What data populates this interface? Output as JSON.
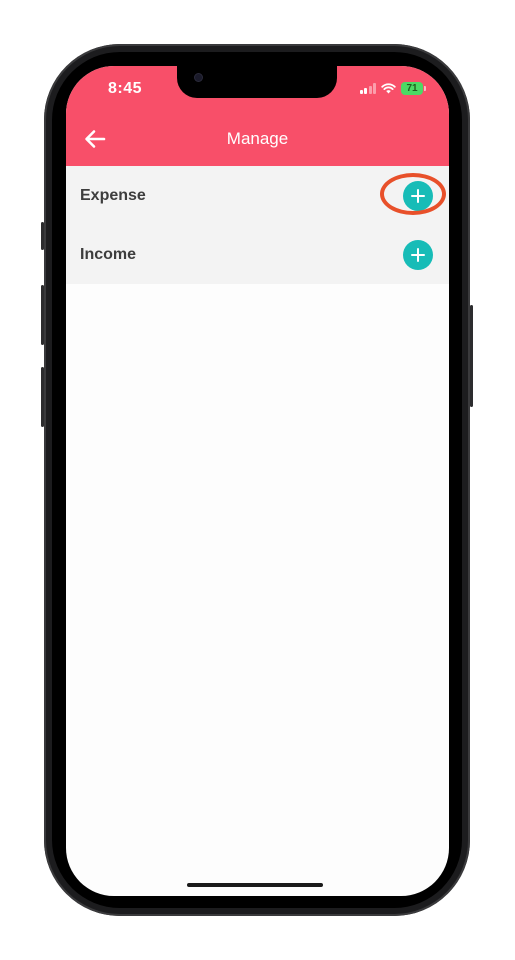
{
  "status_bar": {
    "time": "8:45",
    "battery_level": "71",
    "signal_bars_active": 2,
    "signal_bars_total": 4,
    "icons": [
      "signal-icon",
      "wifi-icon",
      "battery-icon"
    ]
  },
  "header": {
    "title": "Manage",
    "back_icon": "arrow-left-icon"
  },
  "categories": [
    {
      "label": "Expense",
      "action_icon": "plus-icon",
      "highlighted": true
    },
    {
      "label": "Income",
      "action_icon": "plus-icon",
      "highlighted": false
    }
  ],
  "colors": {
    "header": "#f84f69",
    "list_background": "#f3f3f3",
    "add_button": "#17bcb7",
    "highlight_ring": "#e8502a",
    "battery": "#4cd964"
  }
}
